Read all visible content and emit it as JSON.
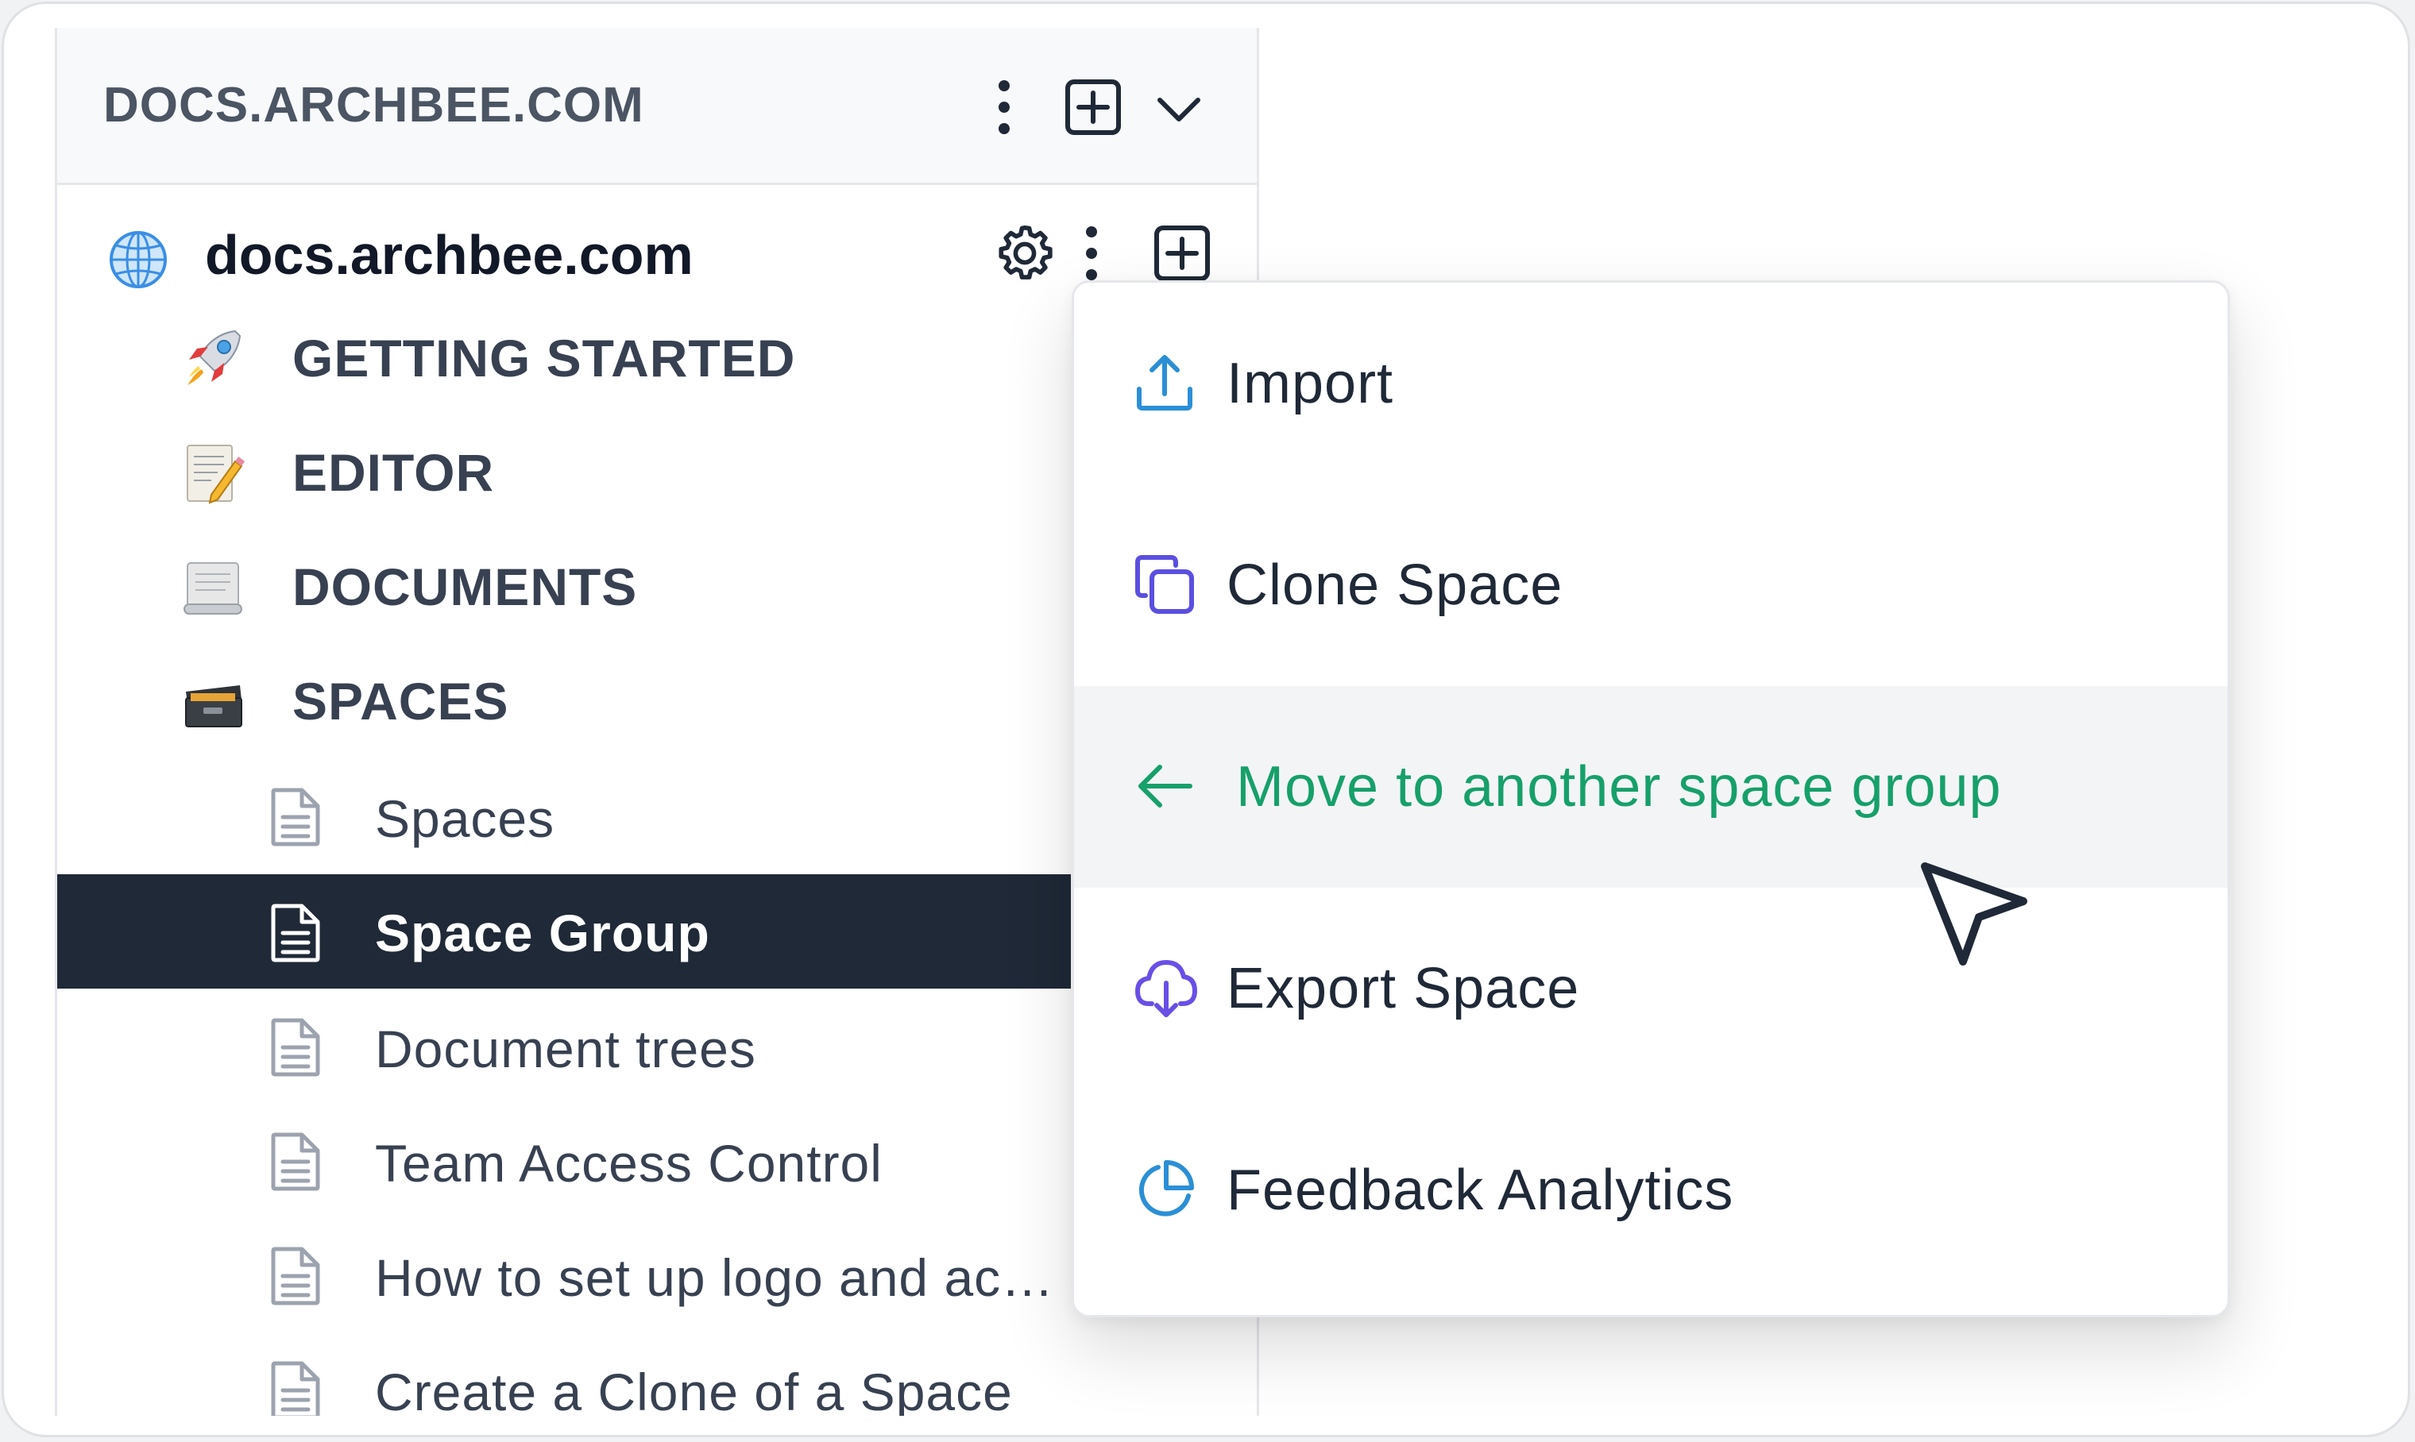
{
  "workspace": {
    "title": "DOCS.ARCHBEE.COM",
    "icons": [
      "more-vertical-icon",
      "add-square-icon",
      "chevron-down-icon"
    ]
  },
  "space": {
    "name": "docs.archbee.com",
    "icons": [
      "globe-icon",
      "gear-icon",
      "more-vertical-icon",
      "add-square-icon"
    ]
  },
  "tree": {
    "sections": [
      {
        "label": "GETTING STARTED",
        "icon": "rocket-icon"
      },
      {
        "label": "EDITOR",
        "icon": "memo-icon"
      },
      {
        "label": "DOCUMENTS",
        "icon": "scroll-icon"
      },
      {
        "label": "SPACES",
        "icon": "card-box-icon"
      }
    ],
    "docs": [
      {
        "label": "Spaces",
        "active": false
      },
      {
        "label": "Space Group",
        "active": true
      },
      {
        "label": "Document trees",
        "active": false
      },
      {
        "label": "Team Access Control",
        "active": false
      },
      {
        "label": "How to set up logo and ac…",
        "active": false
      },
      {
        "label": "Create a Clone of a Space",
        "active": false
      }
    ]
  },
  "menu": {
    "items": [
      {
        "label": "Import",
        "icon": "upload-icon"
      },
      {
        "label": "Clone Space",
        "icon": "copy-icon"
      },
      {
        "label": "Move to another space group",
        "icon": "arrow-left-icon",
        "highlighted": true
      },
      {
        "label": "Export Space",
        "icon": "cloud-download-icon"
      },
      {
        "label": "Feedback Analytics",
        "icon": "pie-chart-icon"
      }
    ]
  },
  "colors": {
    "active_bg": "#1f2937",
    "menu_highlight_text": "#16a06a",
    "menu_highlight_bg": "#f3f4f6",
    "import_icon": "#2b8fd6",
    "clone_icon": "#5b4fe0",
    "export_icon": "#6a4fe6",
    "analytics_icon": "#2b8fd6"
  }
}
